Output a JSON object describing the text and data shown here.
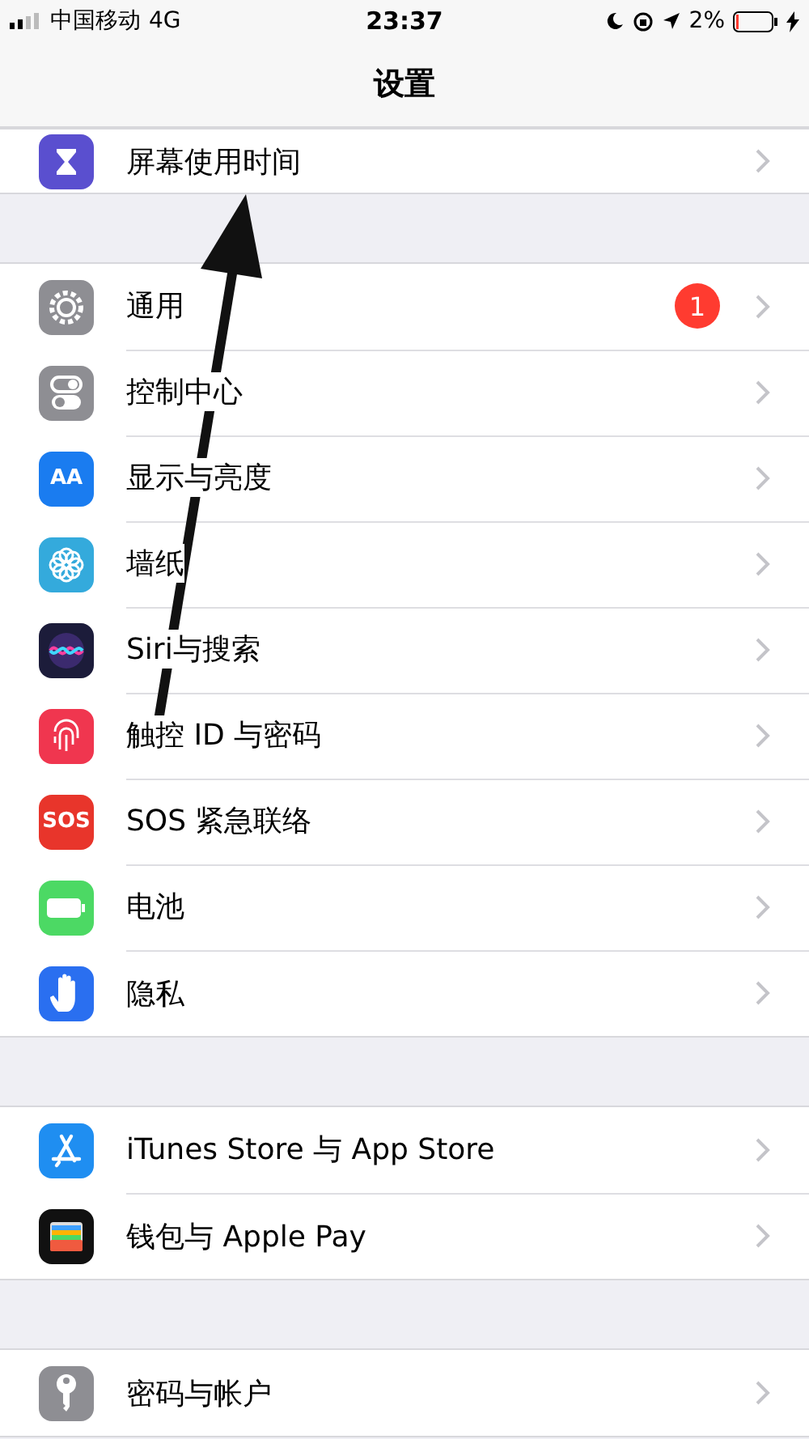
{
  "status_bar": {
    "carrier": "中国移动",
    "network": "4G",
    "time": "23:37",
    "battery": "2%"
  },
  "nav": {
    "title": "设置"
  },
  "groups": [
    {
      "cut": true,
      "rows": [
        {
          "label": "屏幕使用时间",
          "kind": "hourglass"
        }
      ]
    },
    {
      "cut": false,
      "rows": [
        {
          "label": "通用",
          "kind": "gear",
          "badge": "1"
        },
        {
          "label": "控制中心",
          "kind": "toggles"
        },
        {
          "label": "显示与亮度",
          "kind": "text",
          "icon_text": "AA"
        },
        {
          "label": "墙纸",
          "kind": "flower"
        },
        {
          "label": "Siri与搜索",
          "kind": "siri"
        },
        {
          "label": "触控 ID 与密码",
          "kind": "fingerprint"
        },
        {
          "label": "SOS 紧急联络",
          "kind": "sos",
          "icon_text": "SOS"
        },
        {
          "label": "电池",
          "kind": "battery"
        },
        {
          "label": "隐私",
          "kind": "hand"
        }
      ]
    },
    {
      "cut": false,
      "rows": [
        {
          "label": "iTunes Store 与 App Store",
          "kind": "appstore"
        },
        {
          "label": "钱包与 Apple Pay",
          "kind": "wallet"
        }
      ]
    },
    {
      "cut": false,
      "rows": [
        {
          "label": "密码与帐户",
          "kind": "key"
        }
      ]
    }
  ],
  "annotation": {
    "kind": "arrow"
  }
}
